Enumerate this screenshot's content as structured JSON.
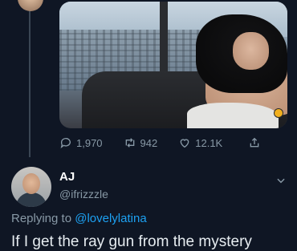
{
  "tweet": {
    "stats": {
      "replies": "1,970",
      "retweets": "942",
      "likes": "12.1K"
    }
  },
  "reply": {
    "name": "AJ",
    "handle": "@ifrizzzle",
    "replying_prefix": "Replying to",
    "replying_to": "@lovelylatina",
    "text": "If I get the ray gun from the mystery"
  },
  "icons": {
    "reply": "reply-icon",
    "retweet": "retweet-icon",
    "like": "heart-icon",
    "share": "share-icon",
    "more": "chevron-down-icon"
  },
  "colors": {
    "background": "#0f1624",
    "muted": "#8899a6",
    "mention": "#1da1f2"
  }
}
